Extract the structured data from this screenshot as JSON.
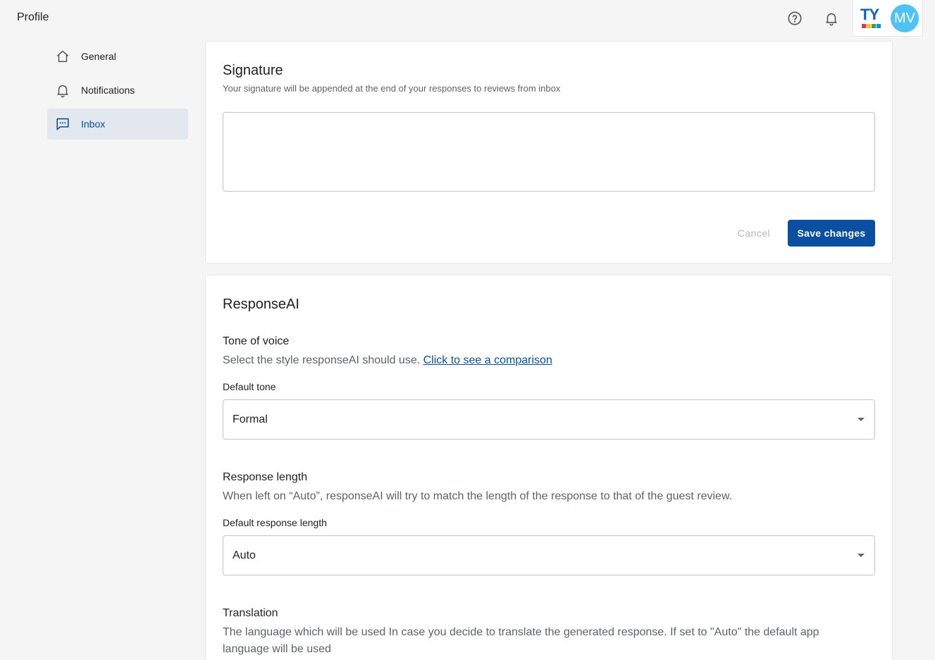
{
  "header": {
    "title": "Profile",
    "brand_letters": "TY",
    "avatar_initials": "MV"
  },
  "icons": {
    "help": "help-icon",
    "notifications": "bell-icon",
    "general": "home-icon",
    "notifications_nav": "bell-icon",
    "inbox": "chat-icon",
    "dropdown": "caret-down-icon"
  },
  "colors": {
    "accent": "#0a4fa0",
    "avatar": "#4fc3f7",
    "active_nav_bg": "#e3e8ef"
  },
  "sidebar": {
    "items": [
      {
        "label": "General",
        "active": false
      },
      {
        "label": "Notifications",
        "active": false
      },
      {
        "label": "Inbox",
        "active": true
      }
    ]
  },
  "signature": {
    "title": "Signature",
    "subtitle": "Your signature will be appended at the end of your responses to reviews from inbox",
    "value": "",
    "cancel_label": "Cancel",
    "save_label": "Save changes"
  },
  "response_ai": {
    "title": "ResponseAI",
    "tone": {
      "title": "Tone of voice",
      "description": "Select the style responseAI should use.",
      "link": "Click to see a comparison",
      "field_label": "Default tone",
      "value": "Formal"
    },
    "length": {
      "title": "Response length",
      "description": "When left on “Auto”, responseAI will try to match the length of the response to that of the guest review.",
      "field_label": "Default response length",
      "value": "Auto"
    },
    "translation": {
      "title": "Translation",
      "description": "The language which will be used In case you decide to translate the generated response. If set to \"Auto\" the default app language will be used"
    }
  }
}
